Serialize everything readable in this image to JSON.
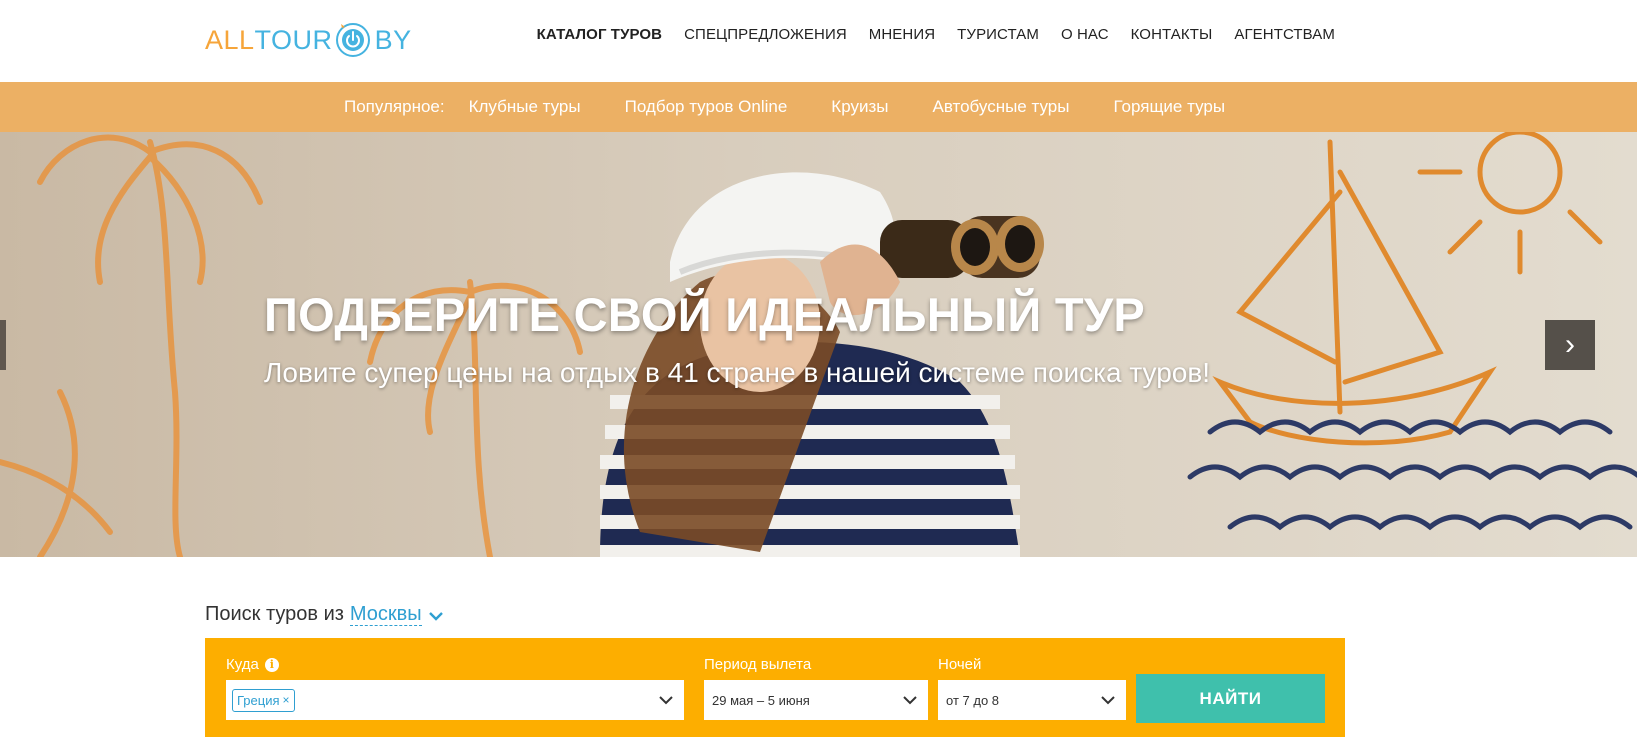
{
  "logo": {
    "part1": "ALL",
    "part2": "TOUR",
    "part3": "BY",
    "icon": "power-icon"
  },
  "nav": [
    {
      "label": "КАТАЛОГ ТУРОВ",
      "active": true
    },
    {
      "label": "СПЕЦПРЕДЛОЖЕНИЯ"
    },
    {
      "label": "МНЕНИЯ"
    },
    {
      "label": "ТУРИСТАМ"
    },
    {
      "label": "О НАС"
    },
    {
      "label": "КОНТАКТЫ"
    },
    {
      "label": "АГЕНТСТВАМ"
    }
  ],
  "popular": {
    "label": "Популярное:",
    "items": [
      "Клубные туры",
      "Подбор туров Online",
      "Круизы",
      "Автобусные туры",
      "Горящие туры"
    ],
    "bg_color": "#ecb064"
  },
  "hero": {
    "title": "ПОДБЕРИТЕ СВОЙ ИДЕАЛЬНЫЙ ТУР",
    "subtitle": "Ловите супер цены на отдых в 41 стране в нашей системе поиска туров!",
    "next_label": "›"
  },
  "search": {
    "title_prefix": "Поиск туров из",
    "city": "Москвы",
    "where_label": "Куда",
    "where_info": "i",
    "where_tag": "Греция",
    "where_tag_remove": "×",
    "period_label": "Период вылета",
    "period_value": "29 мая – 5 июня",
    "nights_label": "Ночей",
    "nights_value": "от 7 до 8",
    "submit": "НАЙТИ",
    "box_color": "#fdae00",
    "button_color": "#3fc0ac",
    "link_color": "#2f9fd1"
  }
}
